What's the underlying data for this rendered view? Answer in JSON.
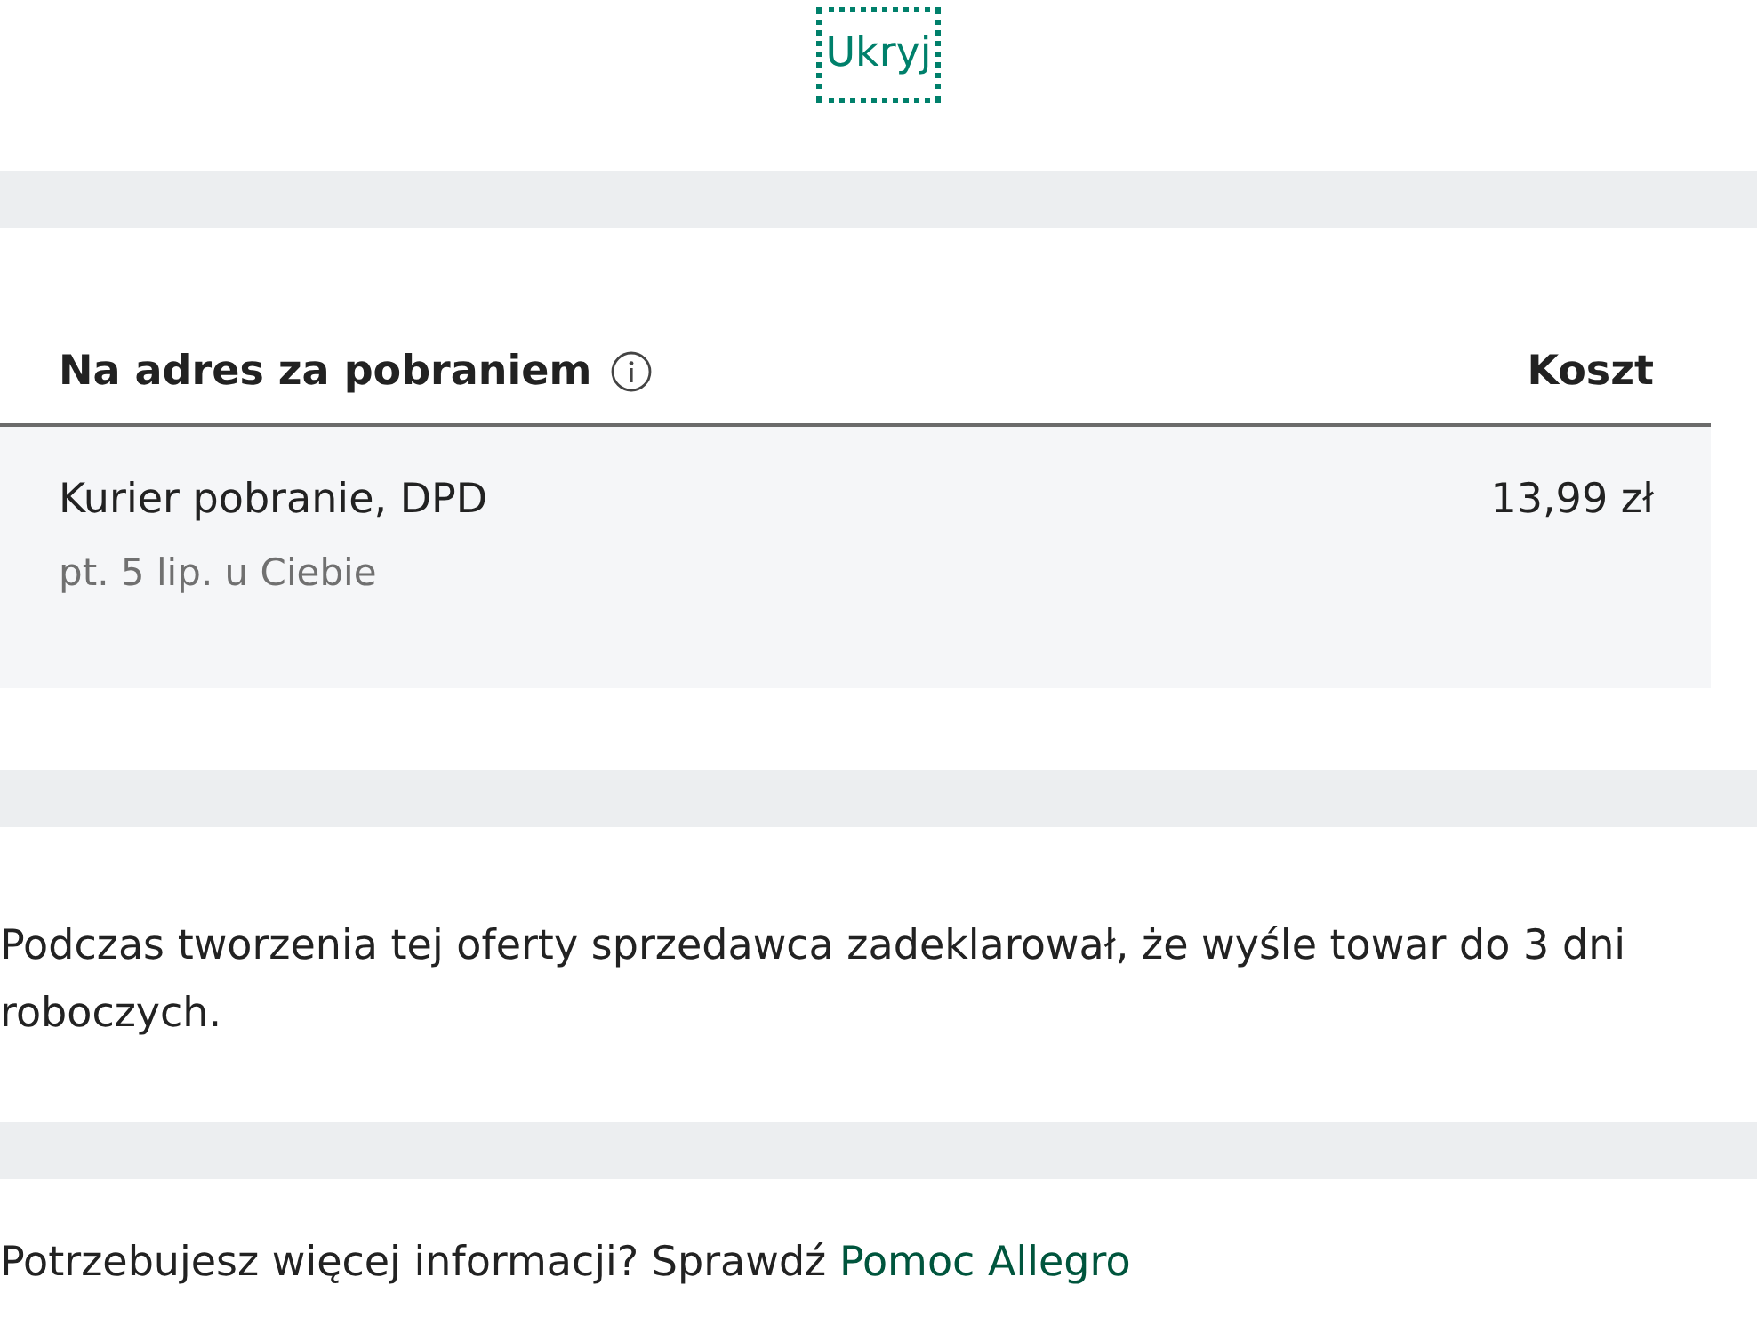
{
  "toggle_link": {
    "label": "Ukryj"
  },
  "delivery_table": {
    "columns": [
      {
        "label": "Na adres za pobraniem",
        "info": true
      },
      {
        "label": "Koszt",
        "info": false
      }
    ],
    "rows": [
      {
        "method": "Kurier pobranie, DPD",
        "eta": "pt. 5 lip. u Ciebie",
        "cost": "13,99 zł"
      }
    ]
  },
  "dispatch_note": "Podczas tworzenia tej oferty sprzedawca zadeklarował, że wyśle towar do 3 dni roboczych.",
  "help": {
    "text": "Potrzebujesz więcej informacji? Sprawdź",
    "link": "Pomoc Allegro"
  }
}
